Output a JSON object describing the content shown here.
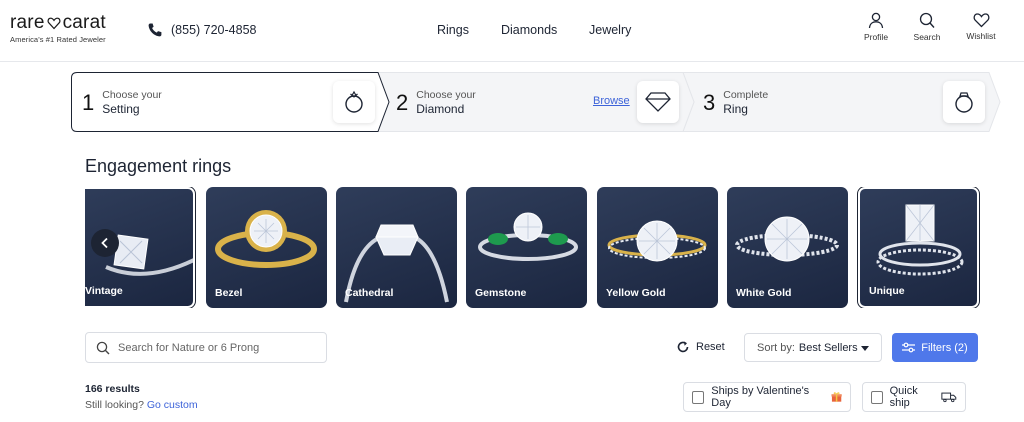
{
  "header": {
    "logo_text": "rare carat",
    "logo_tagline": "America's #1 Rated Jeweler",
    "phone": "(855) 720-4858",
    "nav": [
      "Rings",
      "Diamonds",
      "Jewelry"
    ],
    "utility": [
      {
        "label": "Profile",
        "icon": "person-icon"
      },
      {
        "label": "Search",
        "icon": "search-icon"
      },
      {
        "label": "Wishlist",
        "icon": "heart-icon"
      }
    ]
  },
  "steps": [
    {
      "number": "1",
      "line1": "Choose your",
      "line2": "Setting",
      "icon": "ring-setting-icon",
      "active": true
    },
    {
      "number": "2",
      "line1": "Choose your",
      "line2": "Diamond",
      "link": "Browse",
      "icon": "diamond-icon"
    },
    {
      "number": "3",
      "line1": "Complete",
      "line2": "Ring",
      "icon": "ring-icon"
    }
  ],
  "section_title": "Engagement rings",
  "categories": [
    "Vintage",
    "Bezel",
    "Cathedral",
    "Gemstone",
    "Yellow Gold",
    "White Gold",
    "Unique"
  ],
  "toolbar": {
    "search_placeholder": "Search for Nature or 6 Prong",
    "reset_label": "Reset",
    "sort_prefix": "Sort by:",
    "sort_value": "Best Sellers",
    "filters_label": "Filters (2)"
  },
  "results": {
    "count": "166 results",
    "still_looking": "Still looking?",
    "go_custom": "Go custom"
  },
  "quick_filters": [
    {
      "label": "Ships by Valentine's Day",
      "icon": "gift-icon"
    },
    {
      "label": "Quick ship",
      "icon": "truck-icon"
    }
  ],
  "colors": {
    "accent": "#4f78ea",
    "link": "#3d63d9",
    "card_bg": "#24314d",
    "gold": "#d9b24a"
  }
}
